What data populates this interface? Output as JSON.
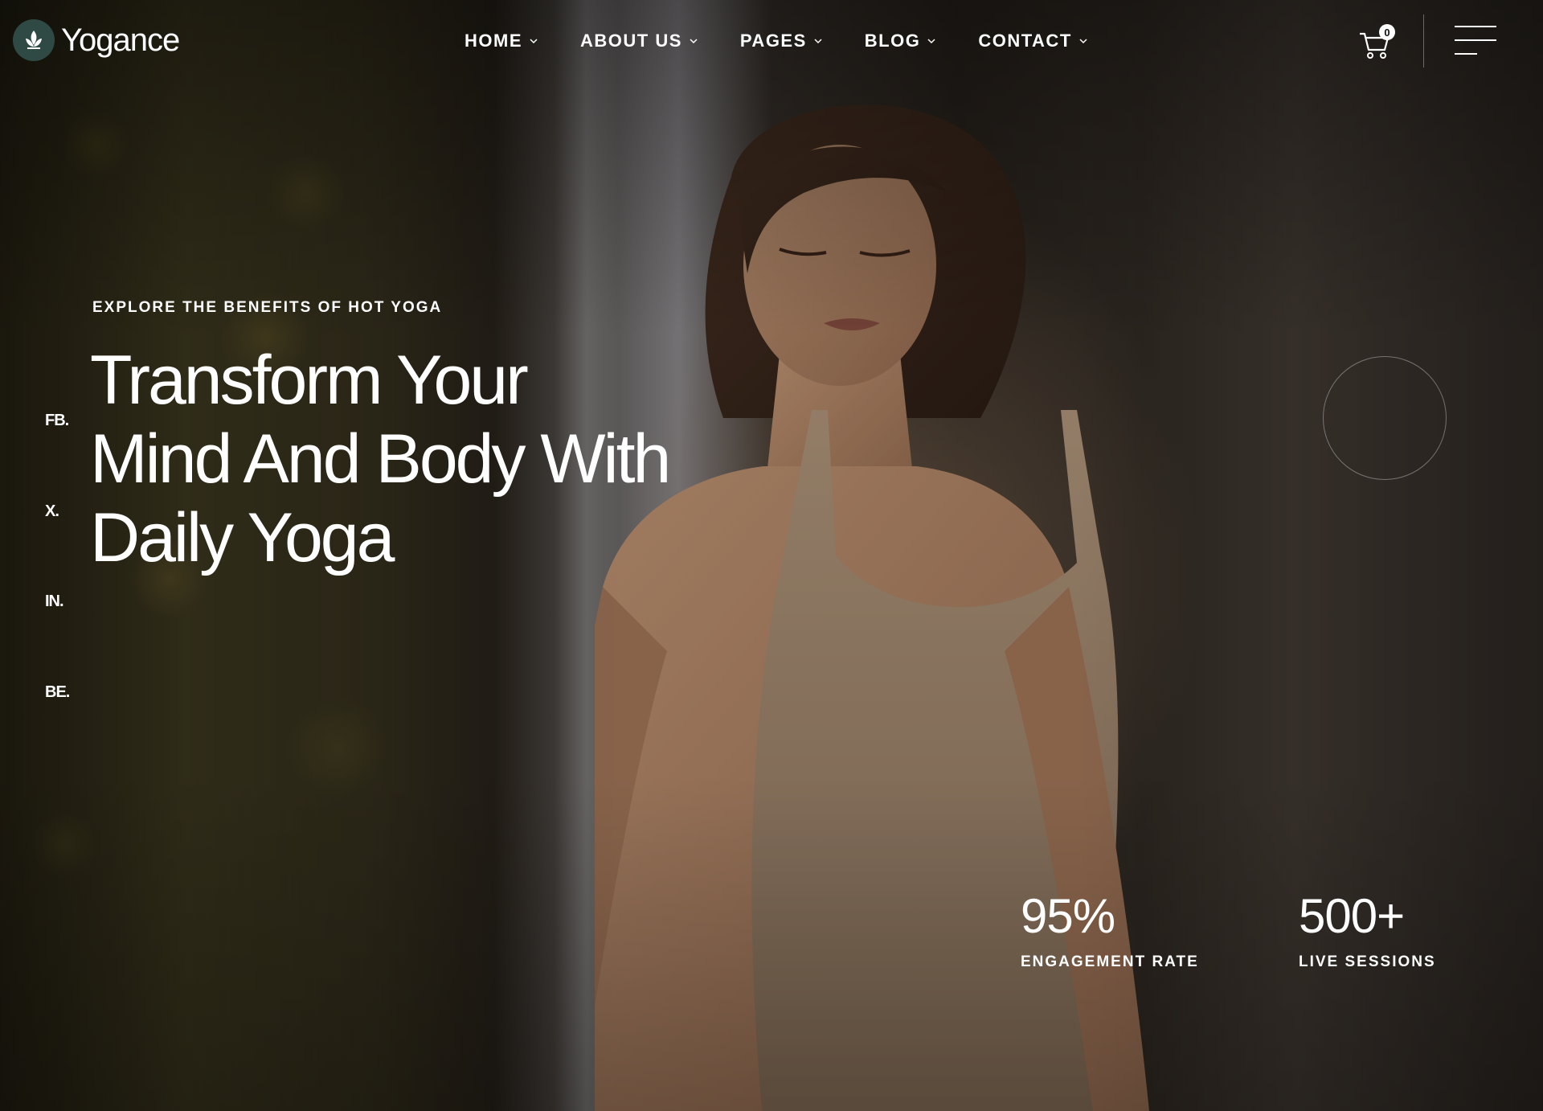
{
  "brand": {
    "name": "Yogance",
    "logo_icon": "lotus-icon",
    "accent_color": "#2f4a45"
  },
  "nav": {
    "items": [
      {
        "label": "HOME"
      },
      {
        "label": "ABOUT US"
      },
      {
        "label": "PAGES"
      },
      {
        "label": "BLOG"
      },
      {
        "label": "CONTACT"
      }
    ]
  },
  "cart": {
    "count": "0",
    "icon": "cart-icon"
  },
  "menu": {
    "icon": "hamburger-menu-icon"
  },
  "social": {
    "items": [
      {
        "label": "FB."
      },
      {
        "label": "X."
      },
      {
        "label": "IN."
      },
      {
        "label": "BE."
      }
    ]
  },
  "hero": {
    "eyebrow": "EXPLORE THE BENEFITS OF HOT YOGA",
    "title_lines": [
      "Transform Your",
      "Mind And Body With",
      "Daily Yoga"
    ]
  },
  "stats": [
    {
      "value": "95%",
      "label": "ENGAGEMENT RATE"
    },
    {
      "value": "500+",
      "label": "LIVE SESSIONS"
    }
  ]
}
